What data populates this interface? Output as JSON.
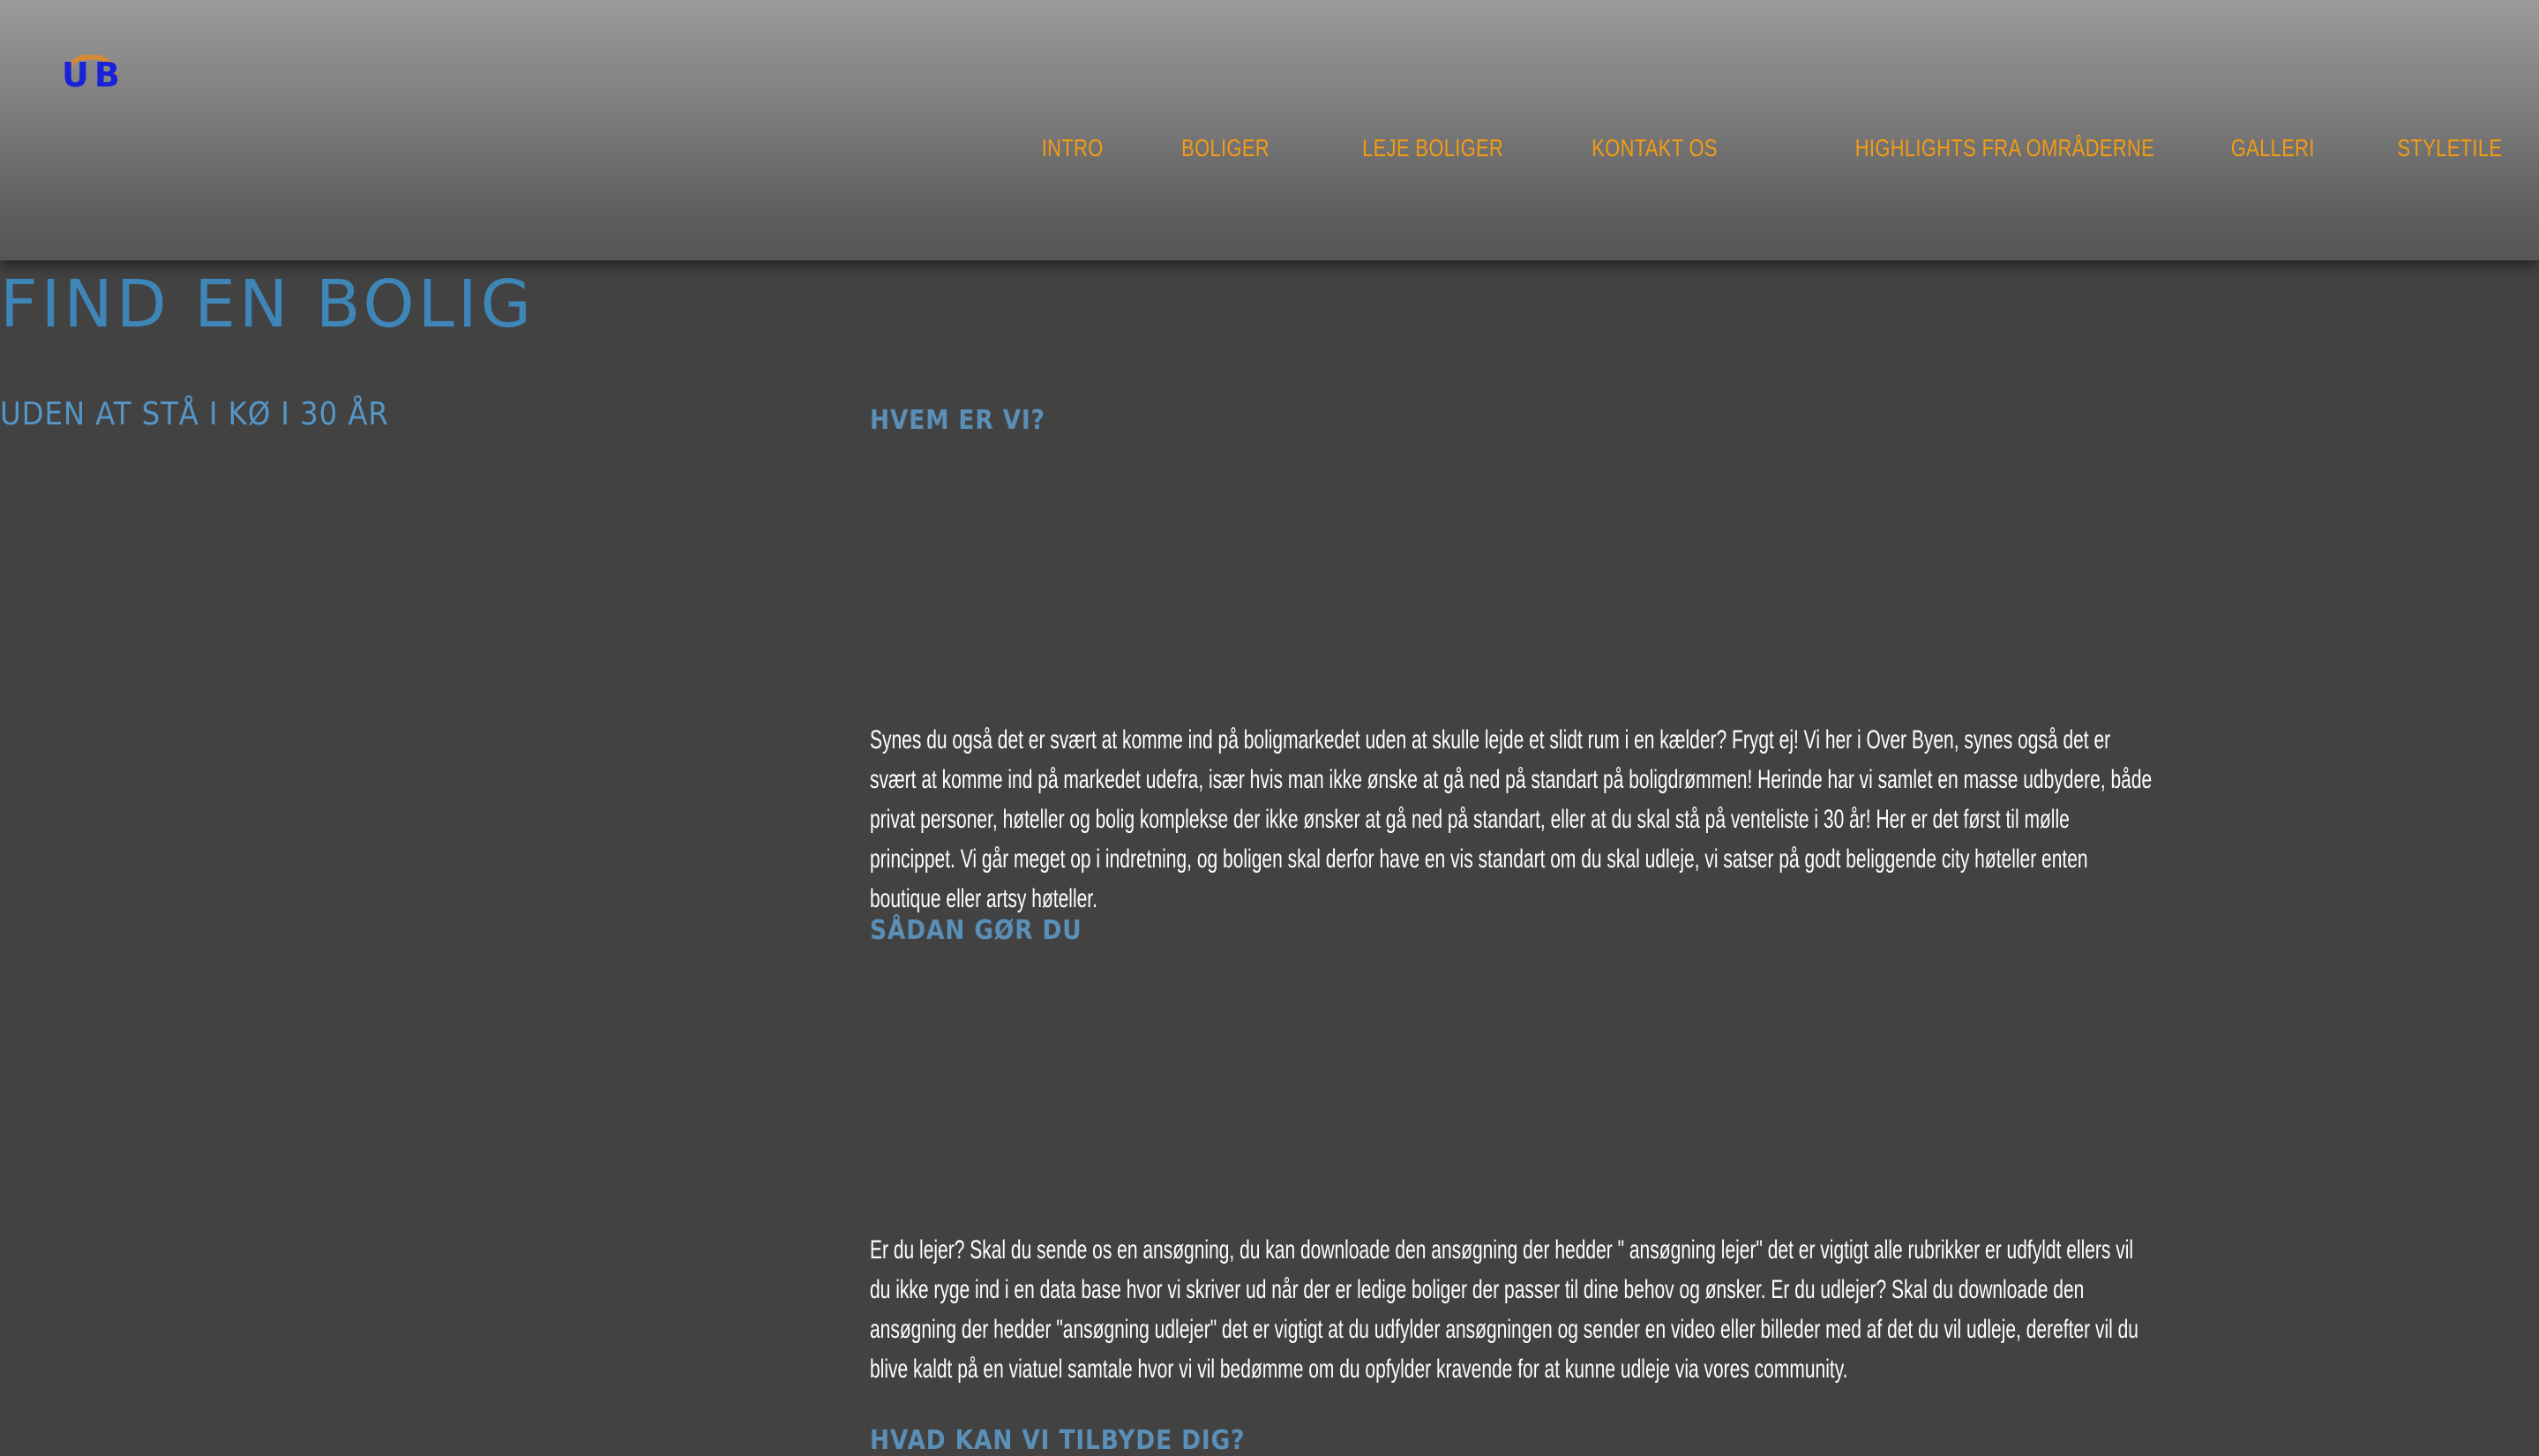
{
  "logo": {
    "text": "UB"
  },
  "nav": {
    "items": [
      "INTRO",
      "BOLIGER",
      "LEJE BOLIGER",
      "KONTAKT OS",
      "HIGHLIGHTS FRA OMRÅDERNE",
      "GALLERI",
      "STYLETILE"
    ]
  },
  "main": {
    "title": "Find en bolig",
    "subtitle": "Uden at stå i kø i 30 år",
    "sections": [
      {
        "heading": "Hvem er vi?",
        "body": "Synes du også det er svært at komme ind på boligmarkedet uden at skulle lejde et slidt rum i en kælder? Frygt ej! Vi her i Over Byen, synes også det er svært at komme ind på markedet udefra, især hvis man ikke ønske at gå ned på standart på boligdrømmen! Herinde har vi samlet en masse udbydere, både privat personer, høteller og bolig komplekse der ikke ønsker at gå ned på standart, eller at du skal stå på venteliste i 30 år! Her er det først til mølle princippet. Vi går meget op i indretning, og boligen skal derfor have en vis standart om du skal udleje, vi satser på godt beliggende city høteller enten boutique eller artsy høteller."
      },
      {
        "heading": "Sådan gør du",
        "body": "Er du lejer? Skal du sende os en ansøgning, du kan downloade den ansøgning der hedder \" ansøgning lejer\" det er vigtigt alle rubrikker er udfyldt ellers vil du ikke ryge ind i en data base hvor vi skriver ud når der er ledige boliger der passer til dine behov og ønsker. Er du udlejer? Skal du downloade den ansøgning der hedder \"ansøgning udlejer\" det er vigtigt at du udfylder ansøgningen og sender en video eller billeder med af det du vil udleje, derefter vil du blive kaldt på en viatuel samtale hvor vi vil bedømme om du opfylder kravende for at kunne udleje via vores community."
      },
      {
        "heading": "Hvad kan vi tilbyde dig?",
        "body": ""
      }
    ]
  },
  "colors": {
    "background": "#424242",
    "nav_text": "#f39c12",
    "title": "#3f86b8",
    "heading": "#5a8fb8",
    "body_text": "#ffffff",
    "logo": "#1a22d8"
  }
}
